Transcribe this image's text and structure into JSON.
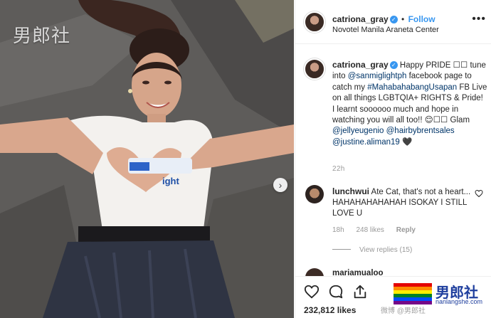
{
  "photo": {
    "watermark": "男郎社",
    "next_icon": "chevron-right-icon",
    "shirt_text": "ight"
  },
  "header": {
    "username": "catriona_gray",
    "separator": "•",
    "follow_label": "Follow",
    "location": "Novotel Manila Araneta Center",
    "more_label": "•••"
  },
  "caption": {
    "username": "catriona_gray",
    "text_1": " Happy PRIDE ☐☐ tune into ",
    "mention_1": "@sanmiglightph",
    "text_2": " facebook page to catch my ",
    "hashtag_1": "#MahabahabangUsapan",
    "text_3": " FB Live on all things LGBTQIA+ RIGHTS & Pride! I learnt soooooo much and hope in watching you will all too!! 😌☐☐ Glam ",
    "mention_2": "@jellyeugenio",
    "mention_3": "@hairbybrentsales",
    "mention_4": "@justine.aliman19",
    "text_4": " 🖤",
    "time": "22h"
  },
  "comment": {
    "username": "lunchwui",
    "text": " Ate Cat, that's not a heart... HAHAHAHAHAHAH ISOKAY I STILL LOVE U",
    "age": "18h",
    "likes": "248 likes",
    "reply_label": "Reply",
    "view_replies": "View replies (15)"
  },
  "next_comment": {
    "username_partial": "mariamualoo"
  },
  "actions": {
    "likes_count": "232,812 likes"
  },
  "watermark": {
    "brand": "男郎社",
    "url": "nanlangshe.com",
    "weibo": "微博 @男郎社"
  },
  "colors": {
    "link": "#003569",
    "follow": "#3897f0",
    "meta": "#999999"
  }
}
